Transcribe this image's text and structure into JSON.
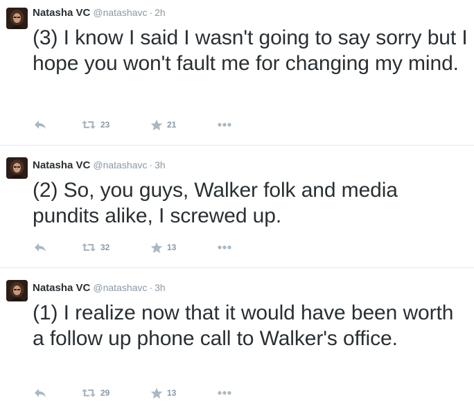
{
  "colors": {
    "text": "#292f33",
    "muted": "#8899a6",
    "icon": "#aab8c2",
    "divider": "#e1e8ed"
  },
  "tweets": [
    {
      "fullname": "Natasha VC",
      "username": "@natashavc",
      "separator": "·",
      "time": "2h",
      "text": "(3) I know I said I wasn't going to say sorry but I hope you won't fault me for changing my mind.",
      "retweets": "23",
      "favorites": "21"
    },
    {
      "fullname": "Natasha VC",
      "username": "@natashavc",
      "separator": "·",
      "time": "3h",
      "text": "(2) So, you guys, Walker folk and media pundits alike, I screwed up.",
      "retweets": "32",
      "favorites": "13"
    },
    {
      "fullname": "Natasha VC",
      "username": "@natashavc",
      "separator": "·",
      "time": "3h",
      "text": "(1) I realize now that it would have been worth a follow up phone call to Walker's office.",
      "retweets": "29",
      "favorites": "13"
    }
  ],
  "icons": {
    "reply": "reply-icon",
    "retweet": "retweet-icon",
    "favorite": "star-icon",
    "more": "more-icon"
  }
}
